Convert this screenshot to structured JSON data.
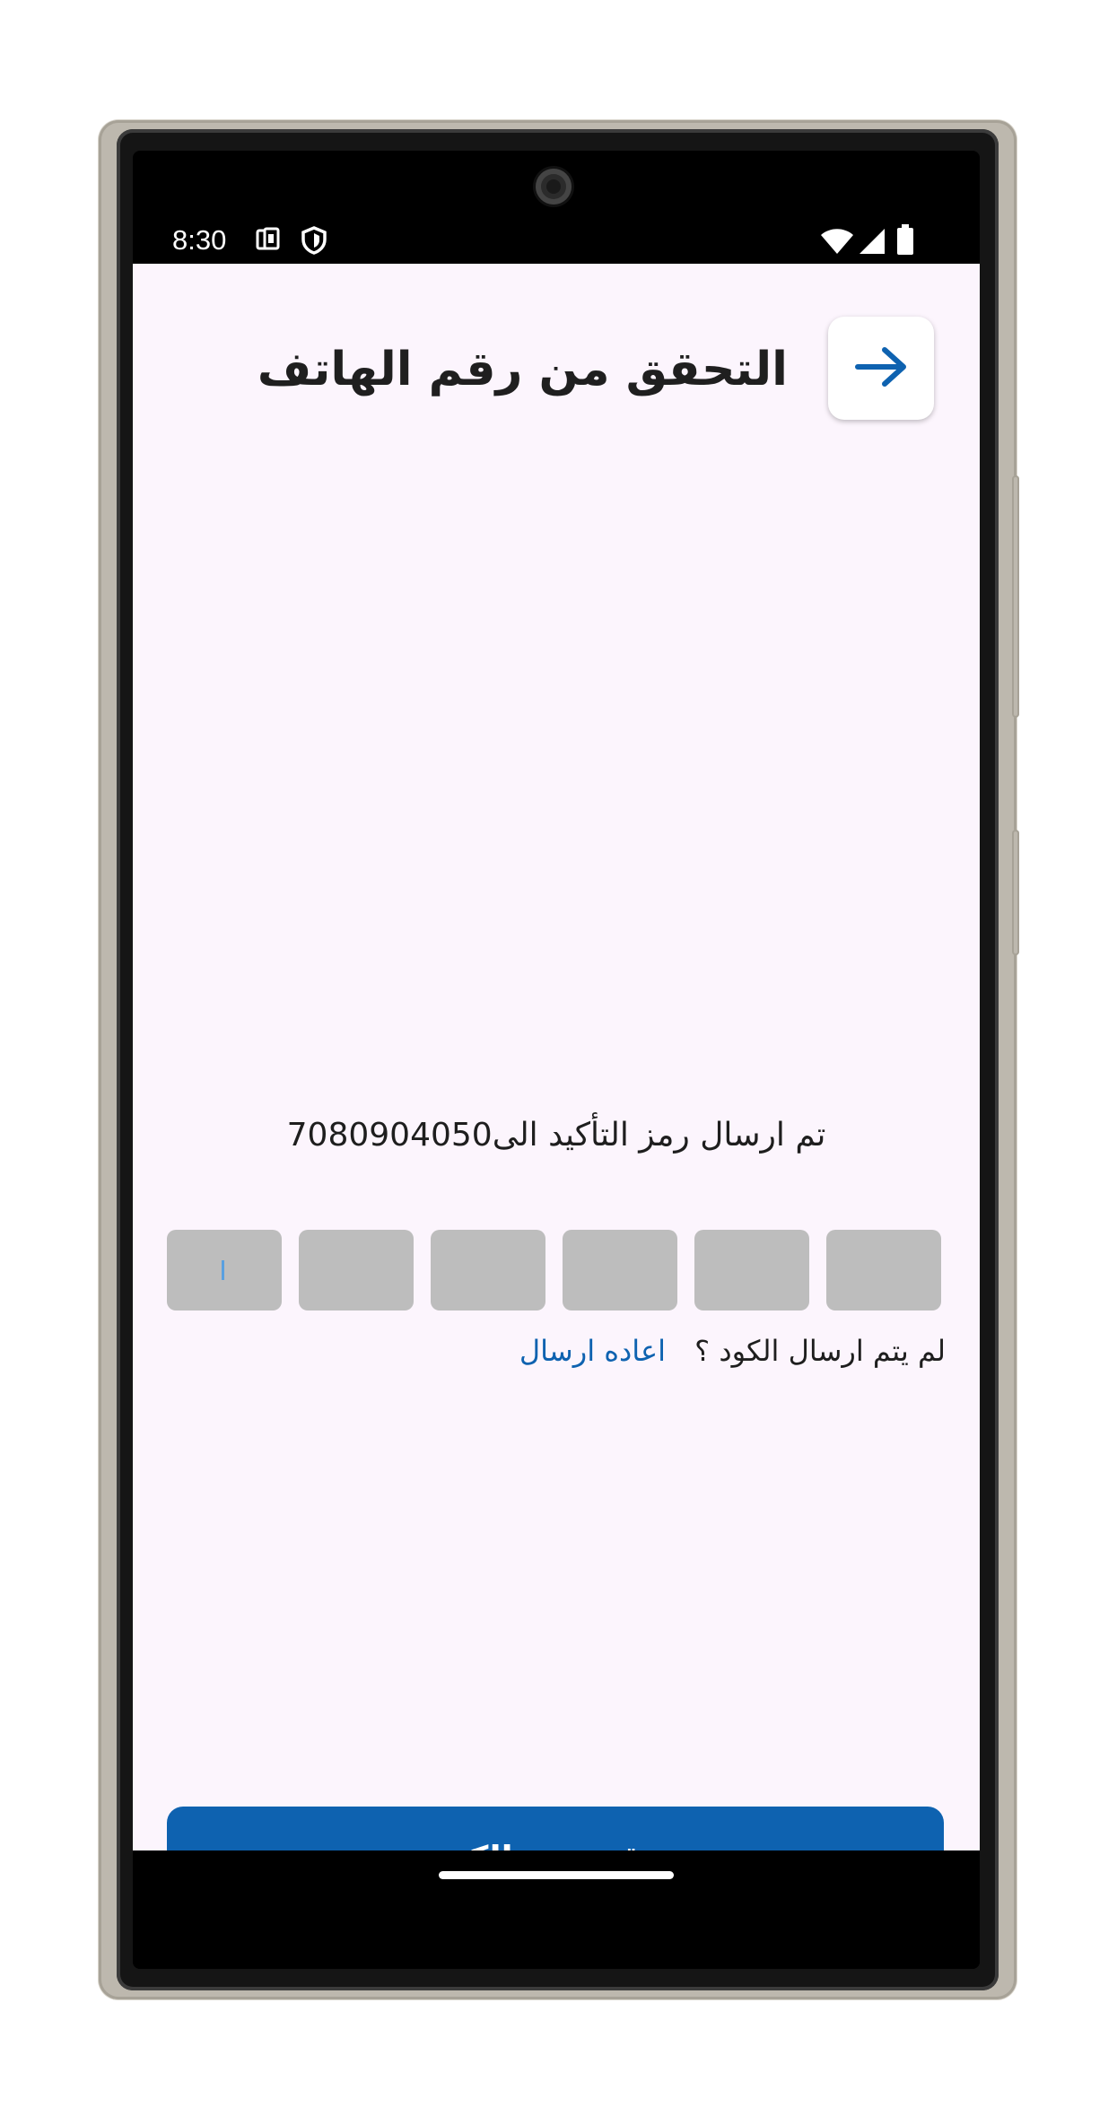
{
  "status_bar": {
    "time": "8:30",
    "icons": [
      "data-saver-icon",
      "shield-icon",
      "wifi-icon",
      "signal-icon",
      "battery-icon"
    ]
  },
  "header": {
    "title": "التحقق من رقم الهاتف",
    "back_icon": "arrow-right-icon"
  },
  "verification": {
    "message": "تم ارسال رمز التأكيد الى7080904050",
    "otp_digits": [
      "",
      "",
      "",
      "",
      "",
      ""
    ],
    "resend_question": "لم يتم ارسال الكود ؟",
    "resend_link": "اعاده ارسال"
  },
  "actions": {
    "verify_label": "تحقق من الكود"
  },
  "colors": {
    "primary": "#0e62b0",
    "background": "#fcf5fd",
    "otp_box": "#bdbdbd",
    "title_text": "#1f1f1f"
  }
}
